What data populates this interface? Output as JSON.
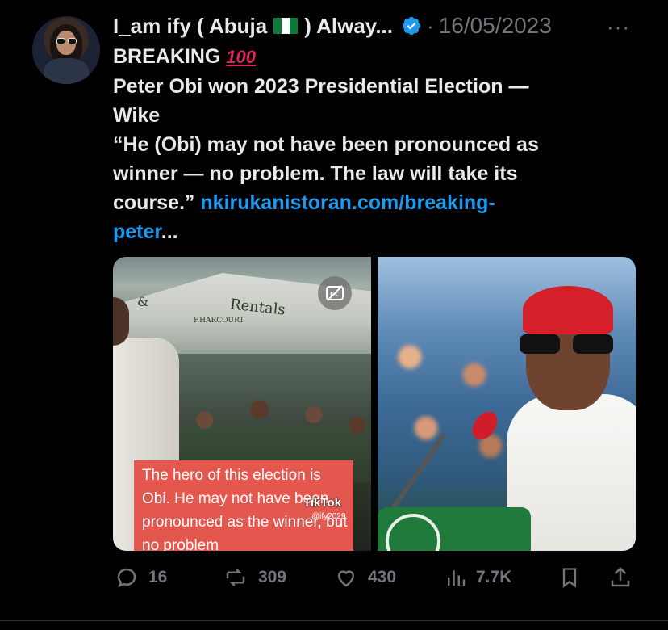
{
  "tweet": {
    "author_name": "I_am ify ( Abuja",
    "author_name_suffix": ") Alway...",
    "dot": "·",
    "date": "16/05/2023",
    "more_label": "···",
    "lines": [
      "BREAKING",
      "Peter Obi won 2023 Presidential Election —",
      "Wike",
      "“He (Obi) may not have been pronounced as",
      "winner — no problem. The law will take its",
      "course.”"
    ],
    "hundred_emoji": "100",
    "link_text_1": "nkirukanistoran.com/breaking-",
    "link_text_2": "peter",
    "link_ellipsis": "..."
  },
  "media": {
    "left": {
      "canopy_text_1": "&",
      "canopy_text_2": "Rentals",
      "canopy_text_3": "P.HARCOURT",
      "caption": "The hero of this election is Obi. He may not have been pronounced as the winner, but no problem",
      "tiktok_label": "TikTok",
      "tiktok_handle": "@ify2029"
    }
  },
  "actions": {
    "replies": "16",
    "reposts": "309",
    "likes": "430",
    "views": "7.7K"
  },
  "colors": {
    "accent": "#1d9bf0",
    "muted": "#71767b",
    "text": "#e7e9ea",
    "background": "#000000"
  }
}
